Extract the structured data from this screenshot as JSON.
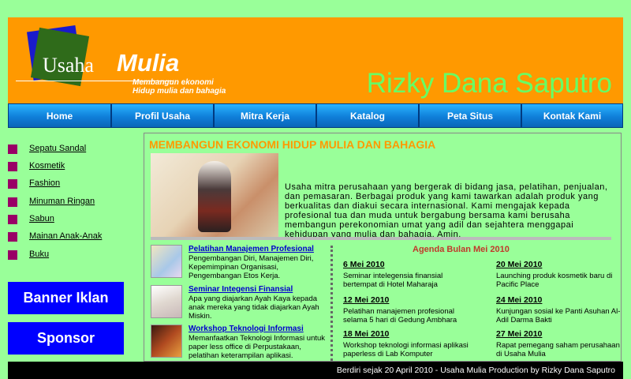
{
  "header": {
    "logo_word1": "Usaha",
    "logo_word2": "Mulia",
    "tagline_line1": "Membangun ekonomi",
    "tagline_line2": "Hidup mulia dan bahagia",
    "owner_name": "Rizky Dana Saputro"
  },
  "nav": {
    "items": [
      "Home",
      "Profil Usaha",
      "Mitra Kerja",
      "Katalog",
      "Peta Situs",
      "Kontak Kami"
    ]
  },
  "sidebar": {
    "items": [
      "Sepatu Sandal",
      "Kosmetik",
      "Fashion",
      "Minuman Ringan",
      "Sabun",
      "Mainan Anak-Anak",
      "Buku"
    ]
  },
  "banners": {
    "ad": "Banner Iklan",
    "sponsor": "Sponsor"
  },
  "main": {
    "title": "MEMBANGUN EKONOMI HIDUP MULIA DAN BAHAGIA",
    "intro": "Usaha mitra perusahaan yang bergerak di bidang jasa, pelatihan, penjualan, dan pemasaran. Berbagai produk yang kami tawarkan adalah produk yang berkualitas dan diakui secara internasional. Kami mengajak kepada profesional tua dan muda untuk bergabung bersama kami berusaha membangun perekonomian umat yang adil dan sejahtera menggapai kehidupan yang mulia dan bahagia. Amin."
  },
  "news": [
    {
      "title": "Pelatihan Manajemen Profesional",
      "body": "Pengembangan Diri, Manajemen Diri, Kepemimpinan Organisasi, Pengembangan Etos Kerja."
    },
    {
      "title": "Seminar Integensi Finansial",
      "body": "Apa yang diajarkan Ayah Kaya kepada anak mereka yang tidak diajarkan Ayah Miskin."
    },
    {
      "title": "Workshop Teknologi Informasi",
      "body": "Memanfaatkan Teknologi Informasi untuk paper less office di Perpustakaan, pelatihan keterampilan aplikasi."
    }
  ],
  "agenda": {
    "title": "Agenda Bulan Mei 2010",
    "events": [
      {
        "date": "6 Mei 2010",
        "desc": "Seminar intelegensia finansial bertempat di Hotel Maharaja"
      },
      {
        "date": "20 Mei 2010",
        "desc": "Launching produk kosmetik baru di Pacific Place"
      },
      {
        "date": "12 Mei 2010",
        "desc": "Pelatihan manajemen profesional selama 5 hari di Gedung Ambhara"
      },
      {
        "date": "24 Mei 2010",
        "desc": "Kunjungan sosial ke Panti Asuhan Al-Adil Darma Bakti"
      },
      {
        "date": "18 Mei 2010",
        "desc": "Workshop teknologi informasi aplikasi paperless di Lab Komputer"
      },
      {
        "date": "27 Mei 2010",
        "desc": "Rapat pemegang saham perusahaan di Usaha Mulia"
      }
    ]
  },
  "footer": {
    "text": "Berdiri sejak 20 April 2010 - Usaha Mulia Production by Rizky Dana Saputro"
  },
  "colors": {
    "page_bg": "#99ff99",
    "header_bg": "#ff9900",
    "nav_blue": "#0f7fd9",
    "banner_blue": "#0000ff",
    "bullet": "#990066",
    "title_orange": "#ff9900",
    "agenda_red": "#c0392b"
  }
}
